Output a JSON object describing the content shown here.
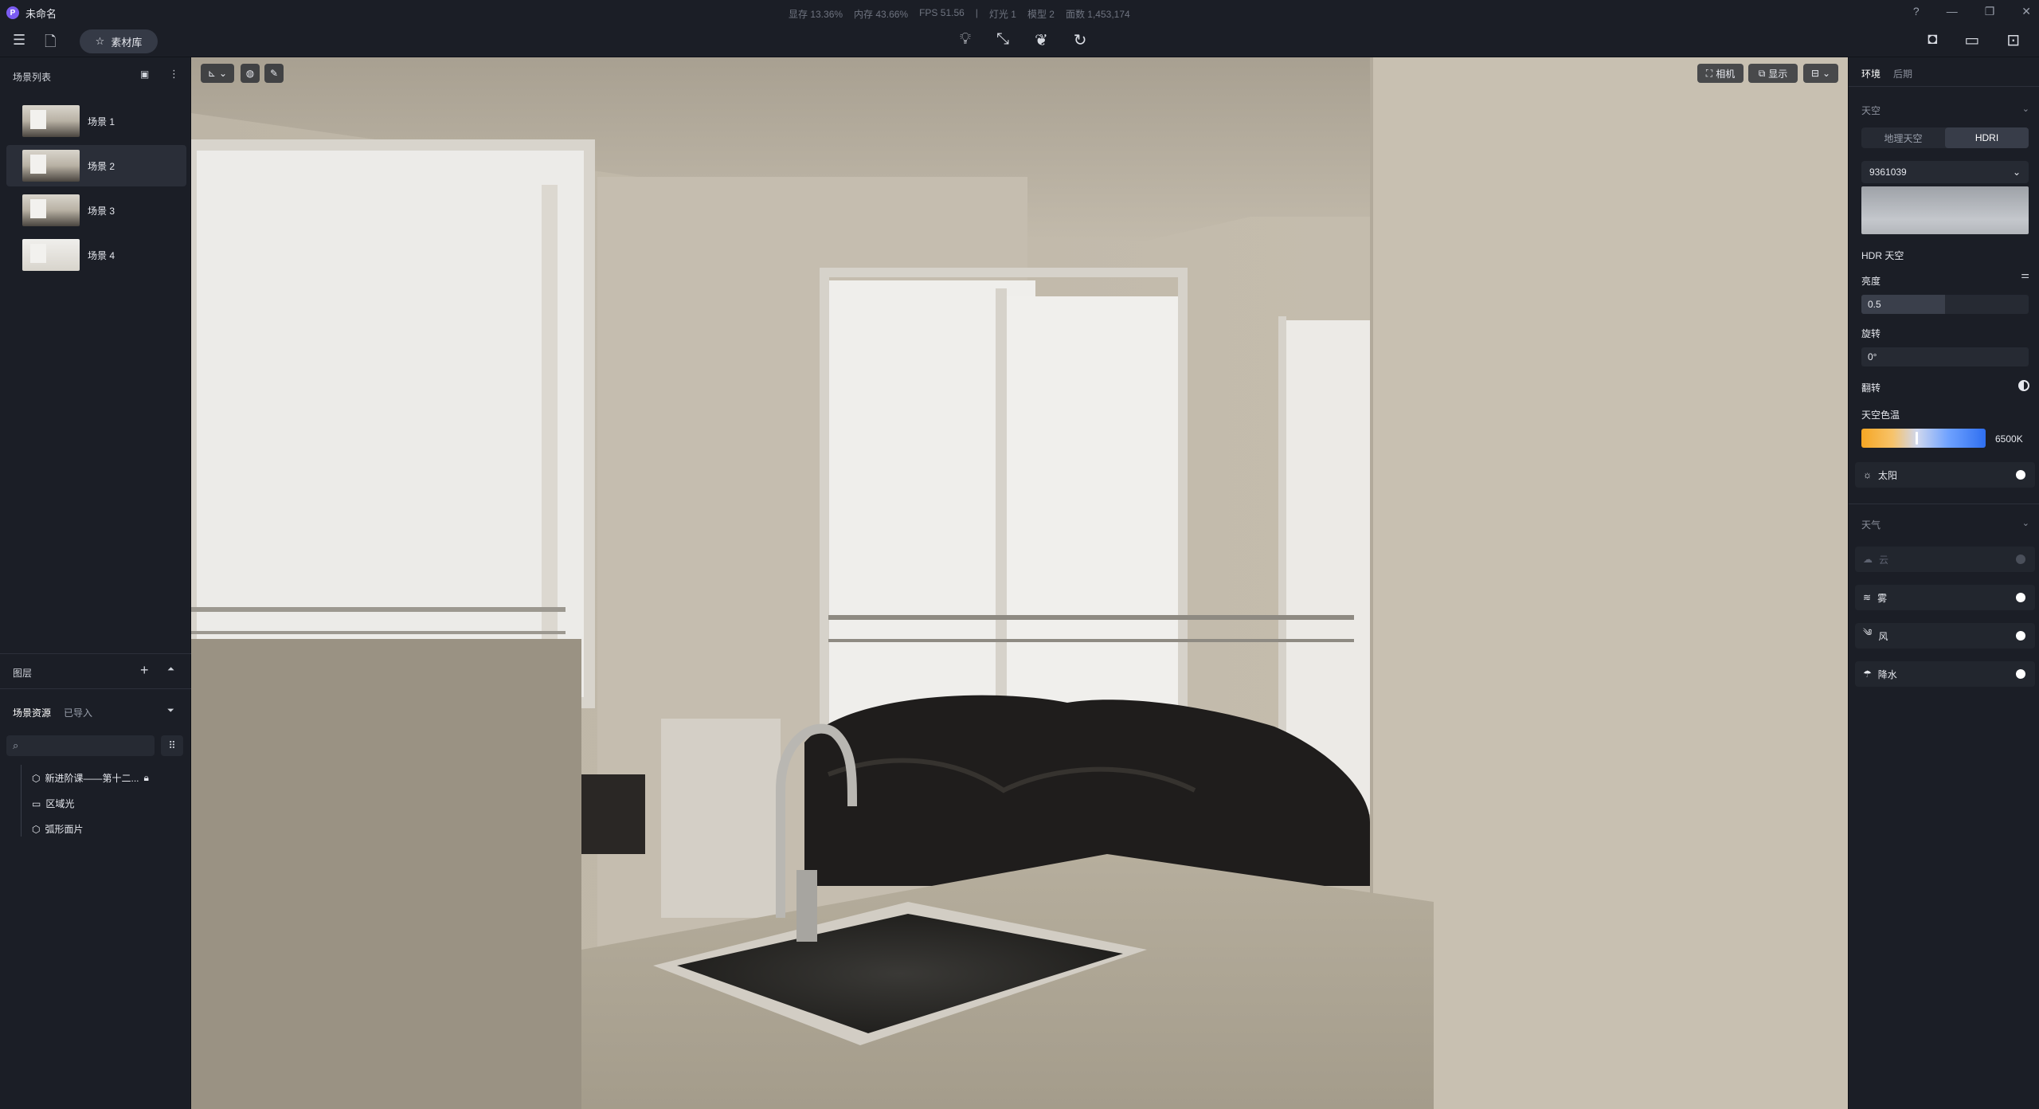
{
  "titlebar": {
    "logo": "P",
    "title": "未命名",
    "stats": [
      "显存 13.36%",
      "内存 43.66%",
      "FPS 51.56",
      "|",
      "灯光 1",
      "模型 2",
      "面数 1,453,174"
    ],
    "controls": [
      "?",
      "—",
      "❐",
      "✕"
    ]
  },
  "toolbar": {
    "menu_icon": "menu-icon",
    "file_icon": "file-icon",
    "library_label": "素材库",
    "center_icons": [
      "bulb-icon",
      "path-icon",
      "leaf-icon",
      "refresh-icon"
    ],
    "right_icons": [
      "camera-icon",
      "video-icon",
      "export-icon"
    ]
  },
  "left_panel": {
    "scenes_title": "场景列表",
    "scenes": [
      {
        "label": "场景 1"
      },
      {
        "label": "场景 2"
      },
      {
        "label": "场景 3"
      },
      {
        "label": "场景 4"
      }
    ],
    "layers_title": "图层",
    "assets_tab": "场景资源",
    "imported_tab": "已导入",
    "tree": [
      {
        "label": "新进阶课——第十二..."
      },
      {
        "label": "区域光"
      },
      {
        "label": "弧形面片"
      }
    ]
  },
  "viewport": {
    "camera_label": "相机",
    "display_label": "显示"
  },
  "right_panel": {
    "tabs": [
      "环境",
      "后期"
    ],
    "sky_title": "天空",
    "sky_modes": [
      "地理天空",
      "HDRI"
    ],
    "hdri_name": "9361039",
    "hdr_sky_label": "HDR 天空",
    "brightness_label": "亮度",
    "brightness_value": "0.5",
    "brightness_fraction": 0.5,
    "rotation_label": "旋转",
    "rotation_value": "0°",
    "flip_label": "翻转",
    "sky_temp_label": "天空色温",
    "sky_temp_value": "6500K",
    "sun_label": "太阳",
    "weather_title": "天气",
    "weather_items": [
      {
        "label": "云",
        "disabled": true
      },
      {
        "label": "雾",
        "disabled": false
      },
      {
        "label": "风",
        "disabled": false
      },
      {
        "label": "降水",
        "disabled": false
      }
    ]
  }
}
